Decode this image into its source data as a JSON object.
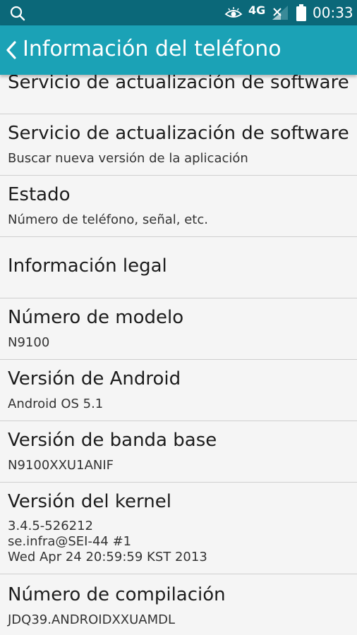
{
  "status_bar": {
    "network": "4G",
    "time": "00:33"
  },
  "app_bar": {
    "title": "Información del teléfono"
  },
  "items": [
    {
      "title": "Servicio de actualización de software"
    },
    {
      "title": "Servicio de actualización de software",
      "subtitle": "Buscar nueva versión de la aplicación"
    },
    {
      "title": "Estado",
      "subtitle": "Número de teléfono, señal, etc."
    },
    {
      "title": "Información legal"
    },
    {
      "title": "Número de modelo",
      "subtitle": "N9100"
    },
    {
      "title": "Versión de Android",
      "subtitle": "Android OS 5.1"
    },
    {
      "title": "Versión de banda base",
      "subtitle": "N9100XXU1ANIF"
    },
    {
      "title": "Versión del kernel",
      "lines": [
        "3.4.5-526212",
        "se.infra@SEI-44 #1",
        "Wed Apr 24 20:59:59 KST 2013"
      ]
    },
    {
      "title": "Número de compilación",
      "subtitle": "JDQ39.ANDROIDXXUAMDL"
    }
  ]
}
